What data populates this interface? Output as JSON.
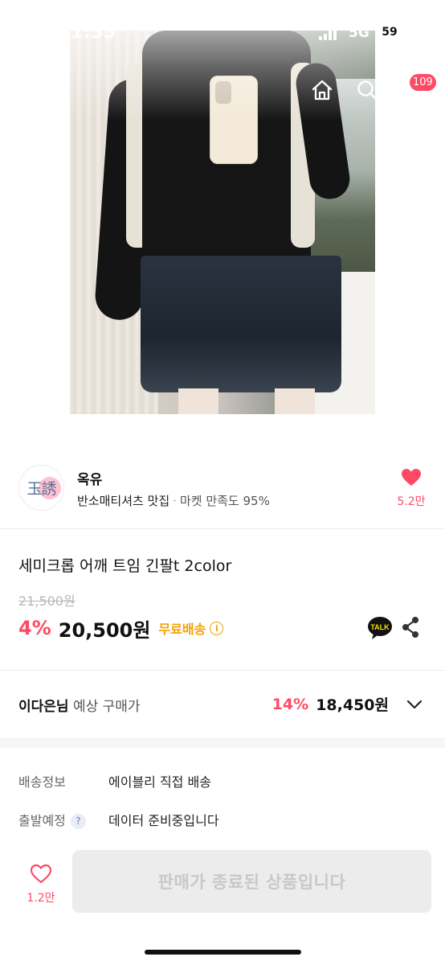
{
  "status_bar": {
    "time": "11:55",
    "network": "5G",
    "battery": "59"
  },
  "nav": {
    "cart_count": "109",
    "icons": [
      "back-icon",
      "home-icon",
      "search-icon",
      "cart-icon"
    ]
  },
  "seller": {
    "avatar_text": "玉誘",
    "name": "옥유",
    "tagline": "반소매티셔츠 맛집",
    "separator": "·",
    "satisfaction": "마켓 만족도 95%",
    "likes": "5.2만"
  },
  "product": {
    "title": "세미크롭 어깨 트임 긴팔t 2color",
    "original_price": "21,500원",
    "discount": "4%",
    "price": "20,500원",
    "shipping": "무료배송",
    "info_symbol": "i",
    "kakao_label": "TALK"
  },
  "expected_price": {
    "user": "이다은님",
    "label": "예상 구매가",
    "discount": "14%",
    "price": "18,450원"
  },
  "delivery": {
    "shipping_label": "배송정보",
    "shipping_value": "에이블리 직접 배송",
    "departure_label": "출발예정",
    "help_symbol": "?",
    "departure_value": "데이터 준비중입니다"
  },
  "bottom_bar": {
    "likes": "1.2만",
    "purchase_button": "판매가 종료된 상품입니다"
  },
  "colors": {
    "accent_pink": "#ff4a66",
    "shipping_orange": "#f6a100",
    "disabled_bg": "#ececec"
  }
}
